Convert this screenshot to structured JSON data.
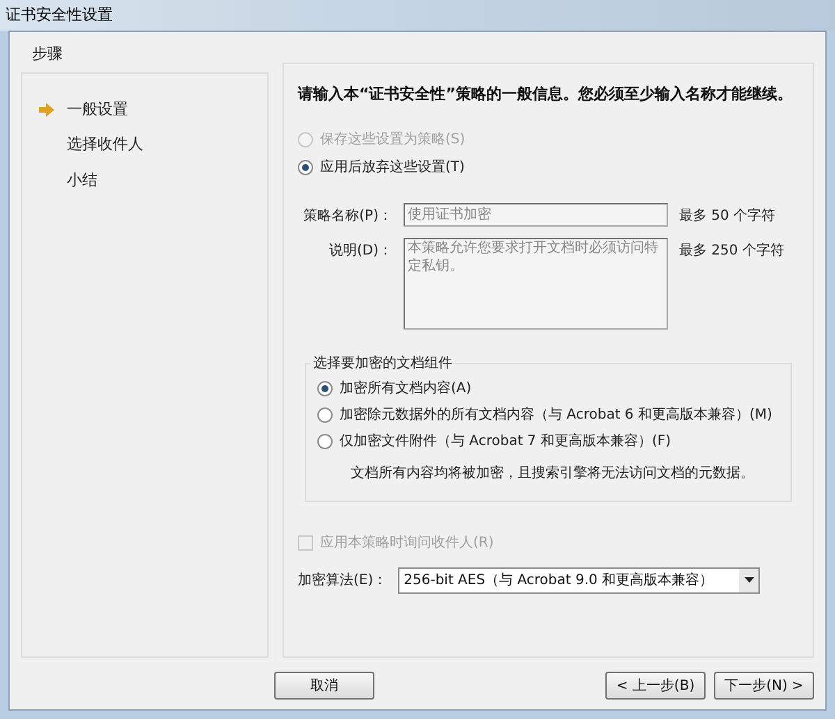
{
  "window": {
    "title": "证书安全性设置"
  },
  "steps": {
    "title": "步骤",
    "items": [
      {
        "label": "一般设置",
        "selected": true
      },
      {
        "label": "选择收件人",
        "selected": false
      },
      {
        "label": "小结",
        "selected": false
      }
    ]
  },
  "heading": "请输入本“证书安全性”策略的一般信息。您必须至少输入名称才能继续。",
  "save_options": [
    {
      "label": "保存这些设置为策略(S)",
      "selected": false,
      "disabled": true
    },
    {
      "label": "应用后放弃这些设置(T)",
      "selected": true,
      "disabled": false
    }
  ],
  "policy_name": {
    "label": "策略名称(P)：",
    "value": "使用证书加密",
    "hint": "最多 50 个字符"
  },
  "description": {
    "label": "说明(D)：",
    "value": "本策略允许您要求打开文档时必须访问特定私钥。",
    "hint": "最多 250 个字符"
  },
  "components": {
    "title": "选择要加密的文档组件",
    "options": [
      {
        "label": "加密所有文档内容(A)",
        "selected": true
      },
      {
        "label": "加密除元数据外的所有文档内容（与 Acrobat 6 和更高版本兼容）(M)",
        "selected": false
      },
      {
        "label": "仅加密文件附件（与 Acrobat 7 和更高版本兼容）(F)",
        "selected": false
      }
    ],
    "note": "文档所有内容均将被加密，且搜索引擎将无法访问文档的元数据。"
  },
  "ask_recipients": {
    "label": "应用本策略时询问收件人(R)",
    "checked": false,
    "disabled": true
  },
  "algorithm": {
    "label": "加密算法(E)：",
    "value": "256-bit AES（与 Acrobat 9.0 和更高版本兼容）"
  },
  "buttons": [
    "取消",
    "< 上一步(B)",
    "下一步(N) >"
  ]
}
